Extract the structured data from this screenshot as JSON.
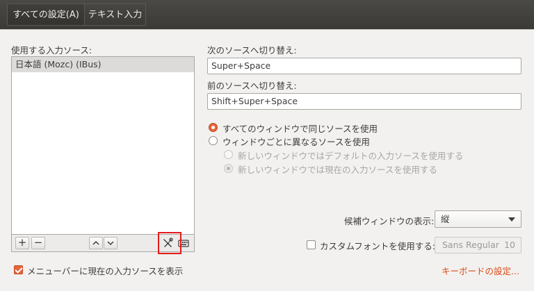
{
  "breadcrumb": {
    "all_settings": "すべての設定(A)",
    "current": "テキスト入力"
  },
  "sources": {
    "label": "使用する入力ソース:",
    "items": [
      "日本語 (Mozc) (IBus)"
    ]
  },
  "toolbar": {
    "add": "+",
    "remove": "−",
    "up": "^",
    "down": "v"
  },
  "shortcuts": {
    "next_label": "次のソースへ切り替え:",
    "next_value": "Super+Space",
    "prev_label": "前のソースへ切り替え:",
    "prev_value": "Shift+Super+Space"
  },
  "options": {
    "same_source": "すべてのウィンドウで同じソースを使用",
    "per_window": "ウィンドウごとに異なるソースを使用",
    "new_default": "新しいウィンドウではデフォルトの入力ソースを使用する",
    "new_current": "新しいウィンドウでは現在の入力ソースを使用する",
    "same_source_selected": true,
    "new_current_selected": true
  },
  "candidate": {
    "label": "候補ウィンドウの表示:",
    "value": "縦"
  },
  "custom_font": {
    "label": "カスタムフォントを使用する:",
    "checked": false,
    "font_name": "Sans Regular",
    "font_size": "10"
  },
  "menubar_option": {
    "label": "メニューバーに現在の入力ソースを表示",
    "checked": true
  },
  "keyboard_settings_link": "キーボードの設定...",
  "colors": {
    "accent": "#e8643a",
    "link": "#dd4814",
    "highlight": "#e21b1b"
  }
}
